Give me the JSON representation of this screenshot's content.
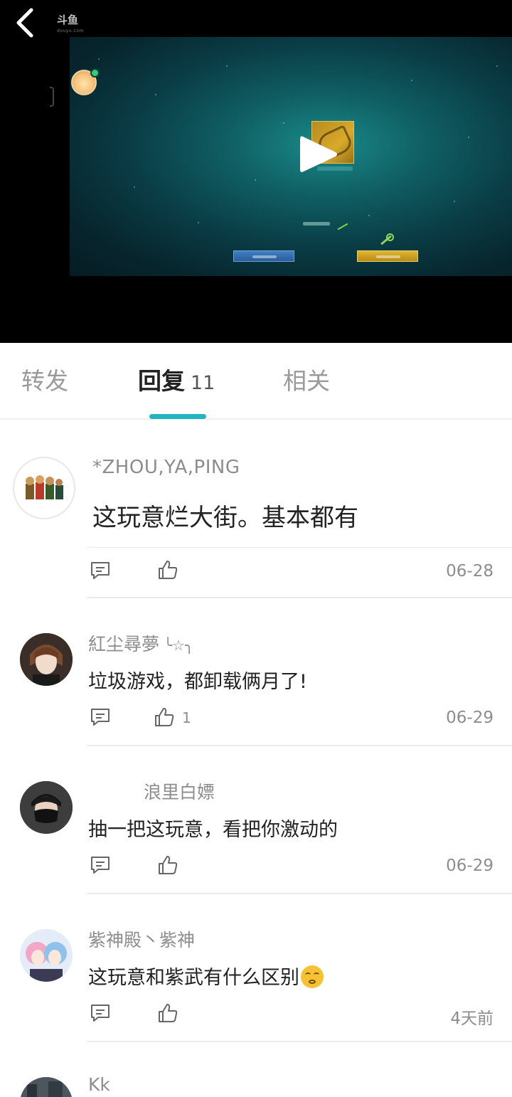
{
  "video": {
    "watermark": "斗鱼",
    "watermark_sub": "douyu.com"
  },
  "tabs": [
    {
      "label": "转发"
    },
    {
      "label": "回复",
      "count": "11"
    },
    {
      "label": "相关"
    }
  ],
  "comments": [
    {
      "username": "*ZHOU,YA,PING",
      "text": "这玩意烂大街。基本都有",
      "likes": "",
      "date": "06-28"
    },
    {
      "username": "紅尘尋夢",
      "username_deco": "╰☆╮",
      "text": "垃圾游戏，都卸载俩月了!",
      "likes": "1",
      "date": "06-29"
    },
    {
      "username": "浪里白嫖",
      "text": "抽一把这玩意，看把你激动的",
      "likes": "",
      "date": "06-29"
    },
    {
      "username": "紫神殿丶紫神",
      "text": "这玩意和紫武有什么区别",
      "emoji": "yawning-face",
      "likes": "",
      "date": "4天前"
    },
    {
      "username": "Kk",
      "text": "",
      "likes": "",
      "date": ""
    }
  ],
  "icons": {
    "back": "chevron-left-icon",
    "play": "play-icon",
    "reply": "comment-icon",
    "like": "thumbs-up-icon"
  },
  "colors": {
    "accent": "#22b5c1",
    "text_primary": "#222222",
    "text_secondary": "#8d8d8d"
  }
}
